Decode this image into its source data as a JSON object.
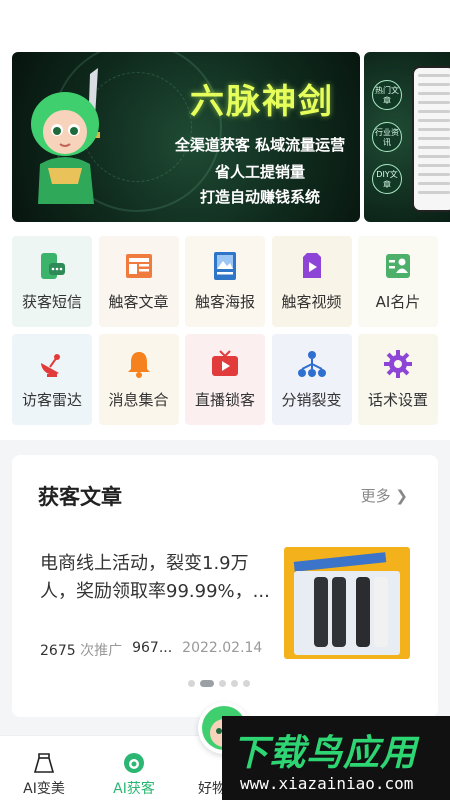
{
  "banner": {
    "title": "六脉神剑",
    "lines": [
      "全渠道获客 私域流量运营",
      "省人工提销量",
      "打造自动赚钱系统"
    ],
    "badges": [
      "热门文章",
      "行业资讯",
      "DIY文章"
    ],
    "slide_count": 6,
    "active_slide": 2
  },
  "features": [
    {
      "label": "获客短信",
      "icon": "sms-icon",
      "bg": "#eef6f4"
    },
    {
      "label": "触客文章",
      "icon": "article-icon",
      "bg": "#fbf5ef"
    },
    {
      "label": "触客海报",
      "icon": "poster-icon",
      "bg": "#fbf7ef"
    },
    {
      "label": "触客视频",
      "icon": "video-icon",
      "bg": "#f8f5e8"
    },
    {
      "label": "AI名片",
      "icon": "card-icon",
      "bg": "#fbfaf2"
    },
    {
      "label": "访客雷达",
      "icon": "radar-icon",
      "bg": "#eef5f8"
    },
    {
      "label": "消息集合",
      "icon": "bell-icon",
      "bg": "#fbf6ec"
    },
    {
      "label": "直播锁客",
      "icon": "tv-icon",
      "bg": "#fcefef"
    },
    {
      "label": "分销裂变",
      "icon": "network-icon",
      "bg": "#f0f2fa"
    },
    {
      "label": "话术设置",
      "icon": "gear-icon",
      "bg": "#f9f7ec"
    }
  ],
  "article_section": {
    "title": "获客文章",
    "more": "更多",
    "item": {
      "text": "电商线上活动，裂变1.9万人，奖励领取率99.99%，...",
      "promotions": "2675",
      "promotions_label": "次推广",
      "views": "967...",
      "date": "2022.02.14"
    },
    "page_count": 5,
    "active_page": 2
  },
  "tabs": [
    {
      "label": "AI变美",
      "icon": "skirt-icon"
    },
    {
      "label": "AI获客",
      "icon": "leaf-icon",
      "active": true
    },
    {
      "label": "好物",
      "icon": "gift-icon"
    }
  ],
  "watermark": {
    "brand": "下载鸟应用",
    "url": "www.xiazainiao.com"
  },
  "colors": {
    "accent": "#2bb673",
    "banner_bg": "#0f2a1d",
    "banner_title": "#e6ff5a"
  }
}
